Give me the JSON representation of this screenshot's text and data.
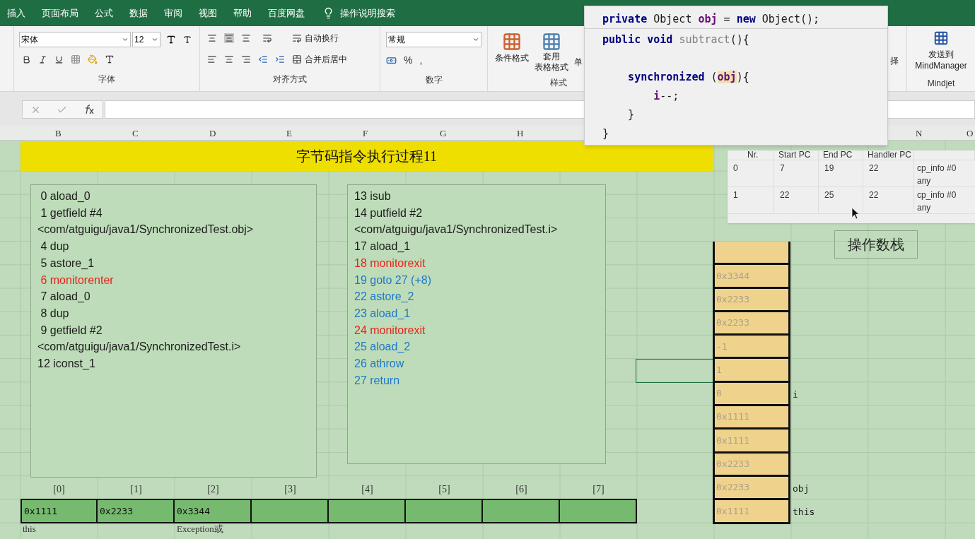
{
  "ribbon_tabs": [
    "插入",
    "页面布局",
    "公式",
    "数据",
    "审阅",
    "视图",
    "帮助",
    "百度网盘"
  ],
  "tell_me": "操作说明搜索",
  "font_group": {
    "font_name": "宋体",
    "font_size": "12",
    "label": "字体"
  },
  "alignment_group": {
    "wrap_text": "自动换行",
    "merge_center": "合并后居中",
    "label": "对齐方式"
  },
  "number_group": {
    "format": "常规",
    "percent": "%",
    "comma": ",",
    "label": "数字"
  },
  "styles_group": {
    "conditional_format": "条件格式",
    "table_format_top": "套用",
    "table_format_bottom": "表格格式",
    "cell_styles_partial": "单",
    "label": "样式"
  },
  "editing_partial": "择",
  "mindjet_group": {
    "send_top": "发送到",
    "send_bottom": "MindManager",
    "label": "Mindjet"
  },
  "column_headers": [
    "B",
    "C",
    "D",
    "E",
    "F",
    "G",
    "H",
    "N",
    "O"
  ],
  "title": "字节码指令执行过程11",
  "bytecode_left": [
    {
      "text": " 0 aload_0",
      "color": "#1a1a1a"
    },
    {
      "text": " 1 getfield #4",
      "color": "#1a1a1a"
    },
    {
      "text": "<com/atguigu/java1/SynchronizedTest.obj>",
      "color": "#1a1a1a"
    },
    {
      "text": " 4 dup",
      "color": "#1a1a1a"
    },
    {
      "text": " 5 astore_1",
      "color": "#1a1a1a"
    },
    {
      "text": " 6 monitorenter",
      "color": "#e8231a"
    },
    {
      "text": " 7 aload_0",
      "color": "#1a1a1a"
    },
    {
      "text": " 8 dup",
      "color": "#1a1a1a"
    },
    {
      "text": " 9 getfield #2",
      "color": "#1a1a1a"
    },
    {
      "text": "<com/atguigu/java1/SynchronizedTest.i>",
      "color": "#1a1a1a"
    },
    {
      "text": "12 iconst_1",
      "color": "#1a1a1a"
    }
  ],
  "bytecode_right": [
    {
      "text": "13 isub",
      "color": "#1a1a1a"
    },
    {
      "text": "14 putfield #2",
      "color": "#1a1a1a"
    },
    {
      "text": "<com/atguigu/java1/SynchronizedTest.i>",
      "color": "#1a1a1a"
    },
    {
      "text": "17 aload_1",
      "color": "#1a1a1a"
    },
    {
      "text": "18 monitorexit",
      "color": "#e8231a"
    },
    {
      "text": "19 goto 27 (+8)",
      "color": "#1f78c8"
    },
    {
      "text": "22 astore_2",
      "color": "#1f78c8"
    },
    {
      "text": "23 aload_1",
      "color": "#1f78c8"
    },
    {
      "text": "24 monitorexit",
      "color": "#e8231a"
    },
    {
      "text": "25 aload_2",
      "color": "#1f78c8"
    },
    {
      "text": "26 athrow",
      "color": "#1f78c8"
    },
    {
      "text": "27 return",
      "color": "#1f78c8"
    }
  ],
  "exception_table": {
    "columns": [
      "Nr.",
      "Start PC",
      "End PC",
      "Handler PC"
    ],
    "rows": [
      [
        "0",
        "7",
        "19",
        "22",
        "cp_info #0",
        "any"
      ],
      [
        "1",
        "22",
        "25",
        "22",
        "cp_info #0",
        "any"
      ]
    ]
  },
  "stack_label": "操作数栈",
  "operand_stack": [
    {
      "value": "0x3344"
    },
    {
      "value": "0x2233"
    },
    {
      "value": "0x2233"
    },
    {
      "value": "-1"
    },
    {
      "value": "1"
    },
    {
      "value": "0",
      "note": "i"
    },
    {
      "value": "0x1111"
    },
    {
      "value": "0x1111"
    },
    {
      "value": "0x2233"
    },
    {
      "value": "0x2233",
      "note": "obj"
    },
    {
      "value": "0x1111",
      "note": "this"
    }
  ],
  "local_variables": [
    {
      "index": "[0]",
      "value": "0x1111",
      "note": "this"
    },
    {
      "index": "[1]",
      "value": "0x2233"
    },
    {
      "index": "[2]",
      "value": "0x3344",
      "note": "Exception或"
    },
    {
      "index": "[3]"
    },
    {
      "index": "[4]"
    },
    {
      "index": "[5]"
    },
    {
      "index": "[6]"
    },
    {
      "index": "[7]"
    }
  ],
  "code_popup": [
    {
      "kind": "code",
      "tokens": [
        {
          "t": "private",
          "kind": "keyword"
        },
        {
          "t": " Object ",
          "kind": "plain"
        },
        {
          "t": "obj",
          "kind": "field"
        },
        {
          "t": " = ",
          "kind": "plain"
        },
        {
          "t": "new",
          "kind": "keyword"
        },
        {
          "t": " Object();",
          "kind": "plain"
        }
      ]
    },
    {
      "kind": "code",
      "tokens": [
        {
          "t": "public void ",
          "kind": "keyword"
        },
        {
          "t": "subtract",
          "kind": "unused"
        },
        {
          "t": "(){",
          "kind": "plain"
        }
      ]
    },
    {
      "kind": "blank"
    },
    {
      "kind": "code",
      "tokens": [
        {
          "t": "    synchronized",
          "kind": "keyword"
        },
        {
          "t": " (",
          "kind": "plain"
        },
        {
          "t": "obj",
          "kind": "highlight"
        },
        {
          "t": "){",
          "kind": "plain"
        }
      ]
    },
    {
      "kind": "code",
      "tokens": [
        {
          "t": "        i",
          "kind": "field"
        },
        {
          "t": "--;",
          "kind": "plain"
        }
      ]
    },
    {
      "kind": "code",
      "tokens": [
        {
          "t": "    }",
          "kind": "plain"
        }
      ]
    },
    {
      "kind": "code",
      "tokens": [
        {
          "t": "}",
          "kind": "plain"
        }
      ]
    }
  ]
}
